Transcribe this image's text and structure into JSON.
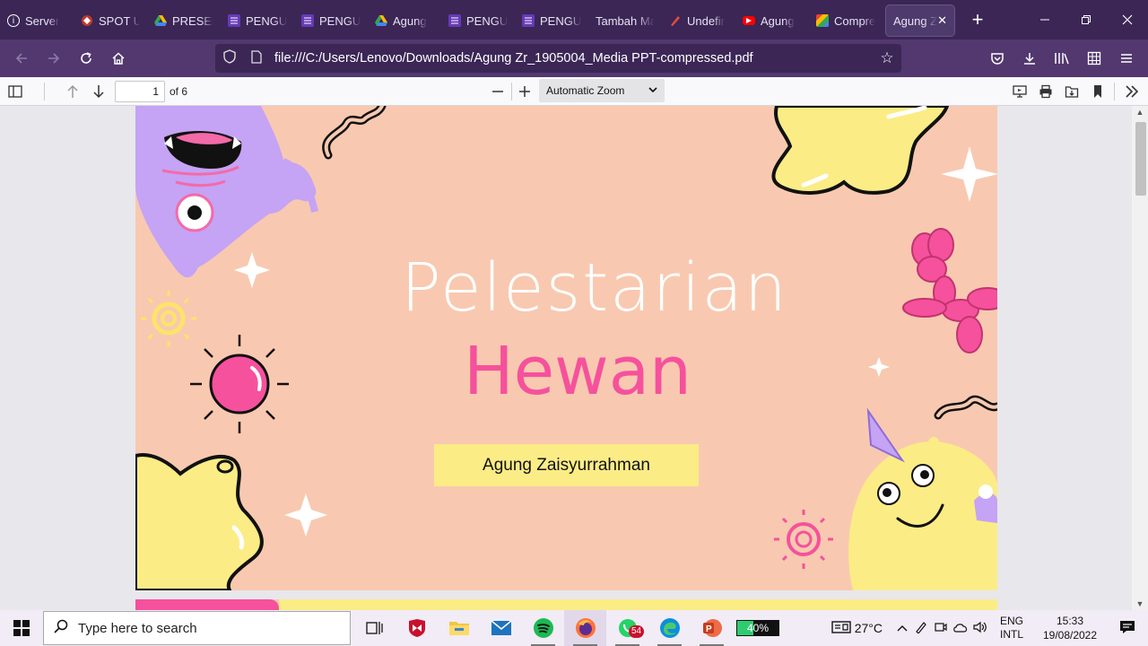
{
  "tabs": [
    {
      "label": "Server",
      "icon": "info-icon",
      "color": "#ffffff"
    },
    {
      "label": "SPOT U",
      "icon": "spot-logo-icon",
      "color": "#c0392b"
    },
    {
      "label": "PRESEN",
      "icon": "google-drive-icon",
      "color": "#34a853"
    },
    {
      "label": "PENGU",
      "icon": "forms-icon",
      "color": "#673ab7"
    },
    {
      "label": "PENGU",
      "icon": "forms-icon",
      "color": "#673ab7"
    },
    {
      "label": "Agung",
      "icon": "google-drive-icon",
      "color": "#34a853"
    },
    {
      "label": "PENGU",
      "icon": "forms-icon",
      "color": "#673ab7"
    },
    {
      "label": "PENGU",
      "icon": "forms-icon",
      "color": "#673ab7"
    },
    {
      "label": "Tambah Ma",
      "icon": "",
      "color": ""
    },
    {
      "label": "Undefir",
      "icon": "pen-icon",
      "color": "#e74c3c"
    },
    {
      "label": "Agung",
      "icon": "youtube-icon",
      "color": "#ff0000"
    },
    {
      "label": "Compre",
      "icon": "compress-icon",
      "color": "#f39c12"
    }
  ],
  "active_tab": {
    "label": "Agung Z",
    "close": "✕"
  },
  "new_tab": "+",
  "url": "file:///C:/Users/Lenovo/Downloads/Agung Zr_1905004_Media PPT-compressed.pdf",
  "pdf": {
    "page": "1",
    "page_of": "of 6",
    "zoom": "Automatic Zoom"
  },
  "slide": {
    "title_line1": "Pelestarian",
    "title_line2": "Hewan",
    "author": "Agung Zaisyurrahman",
    "colors": {
      "background": "#f8c9b0",
      "pink": "#f6519c",
      "yellow": "#fbec86",
      "purple": "#c5a3f5"
    }
  },
  "taskbar": {
    "search_placeholder": "Type here to search",
    "whatsapp_badge": "54",
    "battery": "40%",
    "weather": "27°C",
    "lang1": "ENG",
    "lang2": "INTL",
    "time": "15:33",
    "date": "19/08/2022"
  }
}
